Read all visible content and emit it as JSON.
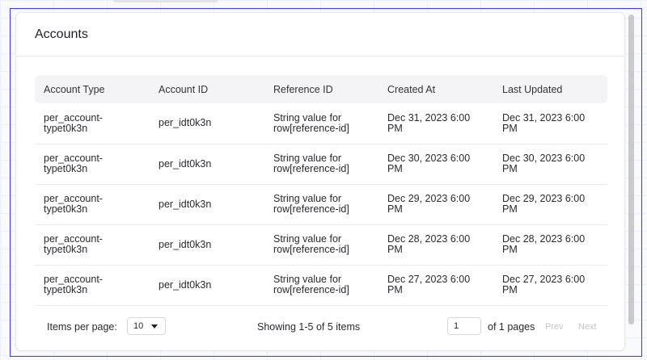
{
  "card": {
    "title": "Accounts"
  },
  "table": {
    "headers": [
      "Account Type",
      "Account ID",
      "Reference ID",
      "Created At",
      "Last Updated"
    ],
    "rows": [
      [
        "per_account-typet0k3n",
        "per_idt0k3n",
        "String value for row[reference-id]",
        "Dec 31, 2023 6:00 PM",
        "Dec 31, 2023 6:00 PM"
      ],
      [
        "per_account-typet0k3n",
        "per_idt0k3n",
        "String value for row[reference-id]",
        "Dec 30, 2023 6:00 PM",
        "Dec 30, 2023 6:00 PM"
      ],
      [
        "per_account-typet0k3n",
        "per_idt0k3n",
        "String value for row[reference-id]",
        "Dec 29, 2023 6:00 PM",
        "Dec 29, 2023 6:00 PM"
      ],
      [
        "per_account-typet0k3n",
        "per_idt0k3n",
        "String value for row[reference-id]",
        "Dec 28, 2023 6:00 PM",
        "Dec 28, 2023 6:00 PM"
      ],
      [
        "per_account-typet0k3n",
        "per_idt0k3n",
        "String value for row[reference-id]",
        "Dec 27, 2023 6:00 PM",
        "Dec 27, 2023 6:00 PM"
      ]
    ]
  },
  "pagination": {
    "items_per_page_label": "Items per page:",
    "items_per_page_value": "10",
    "showing_text": "Showing 1-5 of 5 items",
    "page_value": "1",
    "of_pages_text": "of 1 pages",
    "prev_label": "Prev",
    "next_label": "Next"
  }
}
